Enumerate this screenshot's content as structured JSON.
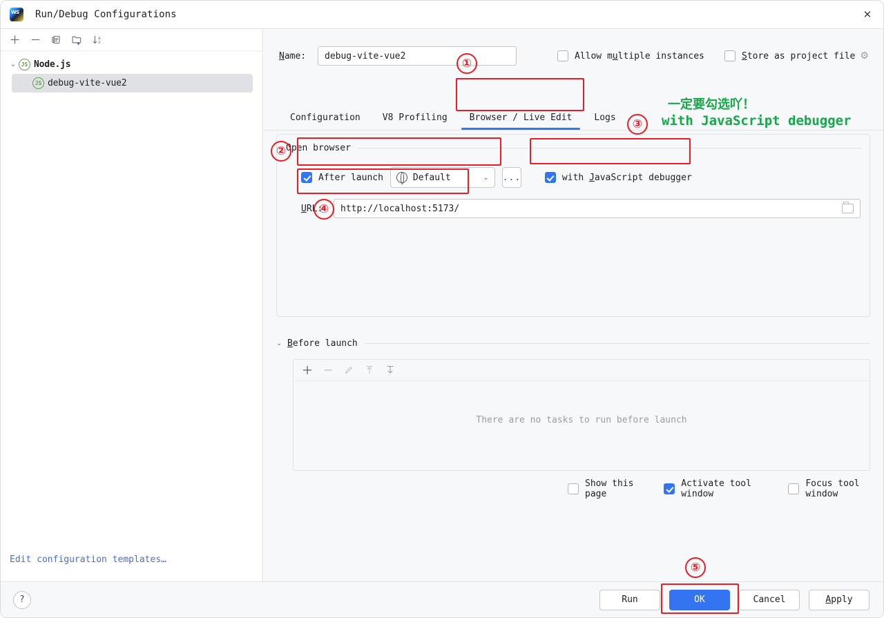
{
  "window": {
    "title": "Run/Debug Configurations",
    "app_icon": "webstorm-logo-icon",
    "close_icon": "✕"
  },
  "sidebar": {
    "toolbar": [
      {
        "name": "add-configuration-button",
        "glyph": "+"
      },
      {
        "name": "remove-configuration-button",
        "glyph": "−"
      },
      {
        "name": "copy-configuration-button",
        "glyph": "▤"
      },
      {
        "name": "new-folder-button",
        "glyph": "🗀"
      },
      {
        "name": "sort-configurations-button",
        "glyph": "↓"
      }
    ],
    "tree": [
      {
        "label": "Node.js",
        "expanded": true,
        "selected": false,
        "level": 0
      },
      {
        "label": "debug-vite-vue2",
        "expanded": false,
        "selected": true,
        "level": 1
      }
    ],
    "edit_templates_link": "Edit configuration templates…"
  },
  "form": {
    "name_label": "Name:",
    "name_value": "debug-vite-vue2",
    "allow_multiple_instances": {
      "label": "Allow multiple instances",
      "checked": false
    },
    "store_as_project_file": {
      "label": "Store as project file",
      "checked": false,
      "gear_icon": "⚙"
    }
  },
  "tabs": [
    {
      "label": "Configuration",
      "active": false
    },
    {
      "label": "V8 Profiling",
      "active": false
    },
    {
      "label": "Browser / Live Edit",
      "active": true
    },
    {
      "label": "Logs",
      "active": false
    }
  ],
  "open_browser": {
    "group_title": "Open browser",
    "after_launch": {
      "label": "After launch",
      "checked": true
    },
    "browser_select": {
      "value": "Default",
      "icon": "globe-icon",
      "arrow": "⌄"
    },
    "more_button": "...",
    "with_js_debugger": {
      "label": "with JavaScript debugger",
      "checked": true
    },
    "url_label": "URL:",
    "url_value": "http://localhost:5173/",
    "browse_icon": "folder-icon"
  },
  "before_launch": {
    "title": "Before launch",
    "expanded": true,
    "toolbar": [
      {
        "name": "add-task-button",
        "glyph": "+",
        "enabled": true
      },
      {
        "name": "remove-task-button",
        "glyph": "−",
        "enabled": false
      },
      {
        "name": "edit-task-button",
        "glyph": "✎",
        "enabled": false
      },
      {
        "name": "move-task-up-button",
        "glyph": "↑",
        "enabled": false
      },
      {
        "name": "move-task-down-button",
        "glyph": "↓",
        "enabled": false
      }
    ],
    "empty_message": "There are no tasks to run before launch",
    "checkboxes": [
      {
        "label": "Show this page",
        "checked": false
      },
      {
        "label": "Activate tool window",
        "checked": true
      },
      {
        "label": "Focus tool window",
        "checked": false
      }
    ]
  },
  "footer": {
    "help_icon": "?",
    "buttons": [
      {
        "label": "Run",
        "primary": false
      },
      {
        "label": "OK",
        "primary": true
      },
      {
        "label": "Cancel",
        "primary": false
      },
      {
        "label": "Apply",
        "primary": false
      }
    ]
  },
  "annotations": {
    "accent_red": "#ec1c24",
    "accent_green": "#17a84a",
    "markers": [
      {
        "number": "①",
        "target": "browser-live-edit-tab"
      },
      {
        "number": "②",
        "target": "after-launch-checkbox"
      },
      {
        "number": "③",
        "target": "with-js-debugger-checkbox"
      },
      {
        "number": "④",
        "target": "url-field"
      },
      {
        "number": "⑤",
        "target": "ok-button"
      }
    ],
    "green_note_cn": "一定要勾选吖！",
    "green_note_en": "with JavaScript debugger"
  }
}
